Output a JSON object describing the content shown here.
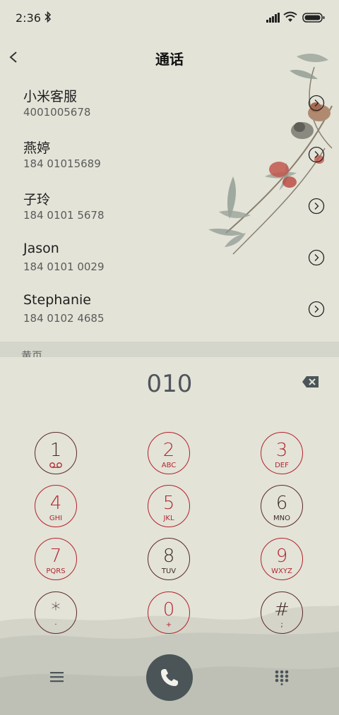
{
  "status_bar": {
    "time": "2:36"
  },
  "header": {
    "title": "通话"
  },
  "contacts": [
    {
      "name": "小米客服",
      "number": "4001005678"
    },
    {
      "name": "燕婷",
      "number": "184 01015689"
    },
    {
      "name": "子玲",
      "number": "184 0101 5678"
    },
    {
      "name": "Jason",
      "number": "184 0101 0029"
    },
    {
      "name": "Stephanie",
      "number": "184 0102 4685"
    }
  ],
  "section": {
    "label": "黄页"
  },
  "dialer": {
    "number": "010"
  },
  "keypad": [
    {
      "digit": "1",
      "letters": ""
    },
    {
      "digit": "2",
      "letters": "ABC"
    },
    {
      "digit": "3",
      "letters": "DEF"
    },
    {
      "digit": "4",
      "letters": "GHI"
    },
    {
      "digit": "5",
      "letters": "JKL"
    },
    {
      "digit": "6",
      "letters": "MNO"
    },
    {
      "digit": "7",
      "letters": "PQRS"
    },
    {
      "digit": "8",
      "letters": "TUV"
    },
    {
      "digit": "9",
      "letters": "WXYZ"
    },
    {
      "digit": "*",
      "letters": "·"
    },
    {
      "digit": "0",
      "letters": "+"
    },
    {
      "digit": "#",
      "letters": ";"
    }
  ],
  "icons": {
    "back": "chevron-left-icon",
    "detail": "chevron-right-circle-icon",
    "delete": "backspace-icon",
    "voicemail": "voicemail-icon",
    "menu": "hamburger-menu-icon",
    "call": "phone-icon",
    "dialpad": "dialpad-grid-icon"
  },
  "colors": {
    "background": "#e3e3d8",
    "key_accent": "#b32228",
    "key_dark": "#5a2a28",
    "call_button": "#4b5558"
  }
}
